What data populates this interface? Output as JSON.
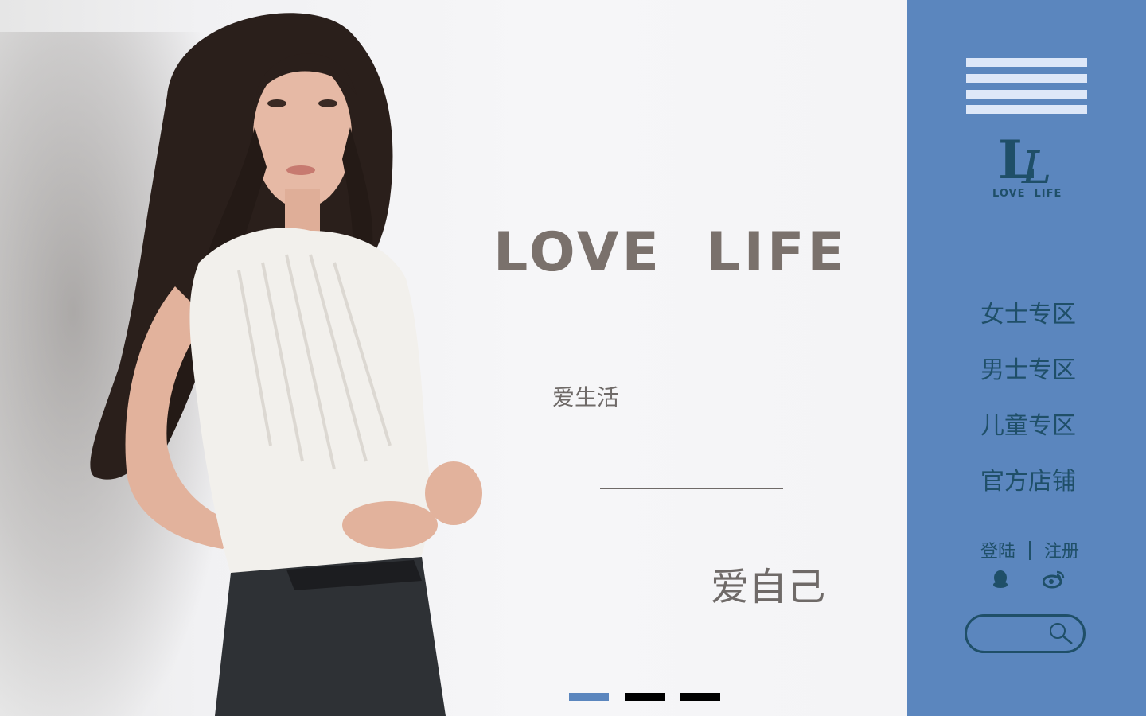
{
  "hero": {
    "headline": "LOVE  LIFE",
    "tagline_1": "爱生活",
    "tagline_2": "爱自己",
    "slides": [
      {
        "index": 1,
        "active": true
      },
      {
        "index": 2,
        "active": false
      },
      {
        "index": 3,
        "active": false
      }
    ]
  },
  "sidebar": {
    "logo": {
      "monogram": "LL",
      "text": "LOVE  LIFE"
    },
    "nav": [
      {
        "label": "女士专区"
      },
      {
        "label": "男士专区"
      },
      {
        "label": "儿童专区"
      },
      {
        "label": "官方店铺"
      }
    ],
    "auth": {
      "login": "登陆",
      "register": "注册"
    },
    "social": [
      {
        "icon": "qq-icon"
      },
      {
        "icon": "weibo-icon"
      }
    ],
    "search": {
      "placeholder": "",
      "icon": "search-icon"
    }
  },
  "colors": {
    "accent": "#5b86be",
    "nav_text": "#1f4f68",
    "headline": "#7a716c",
    "menu_lines": "#dde7f8"
  }
}
